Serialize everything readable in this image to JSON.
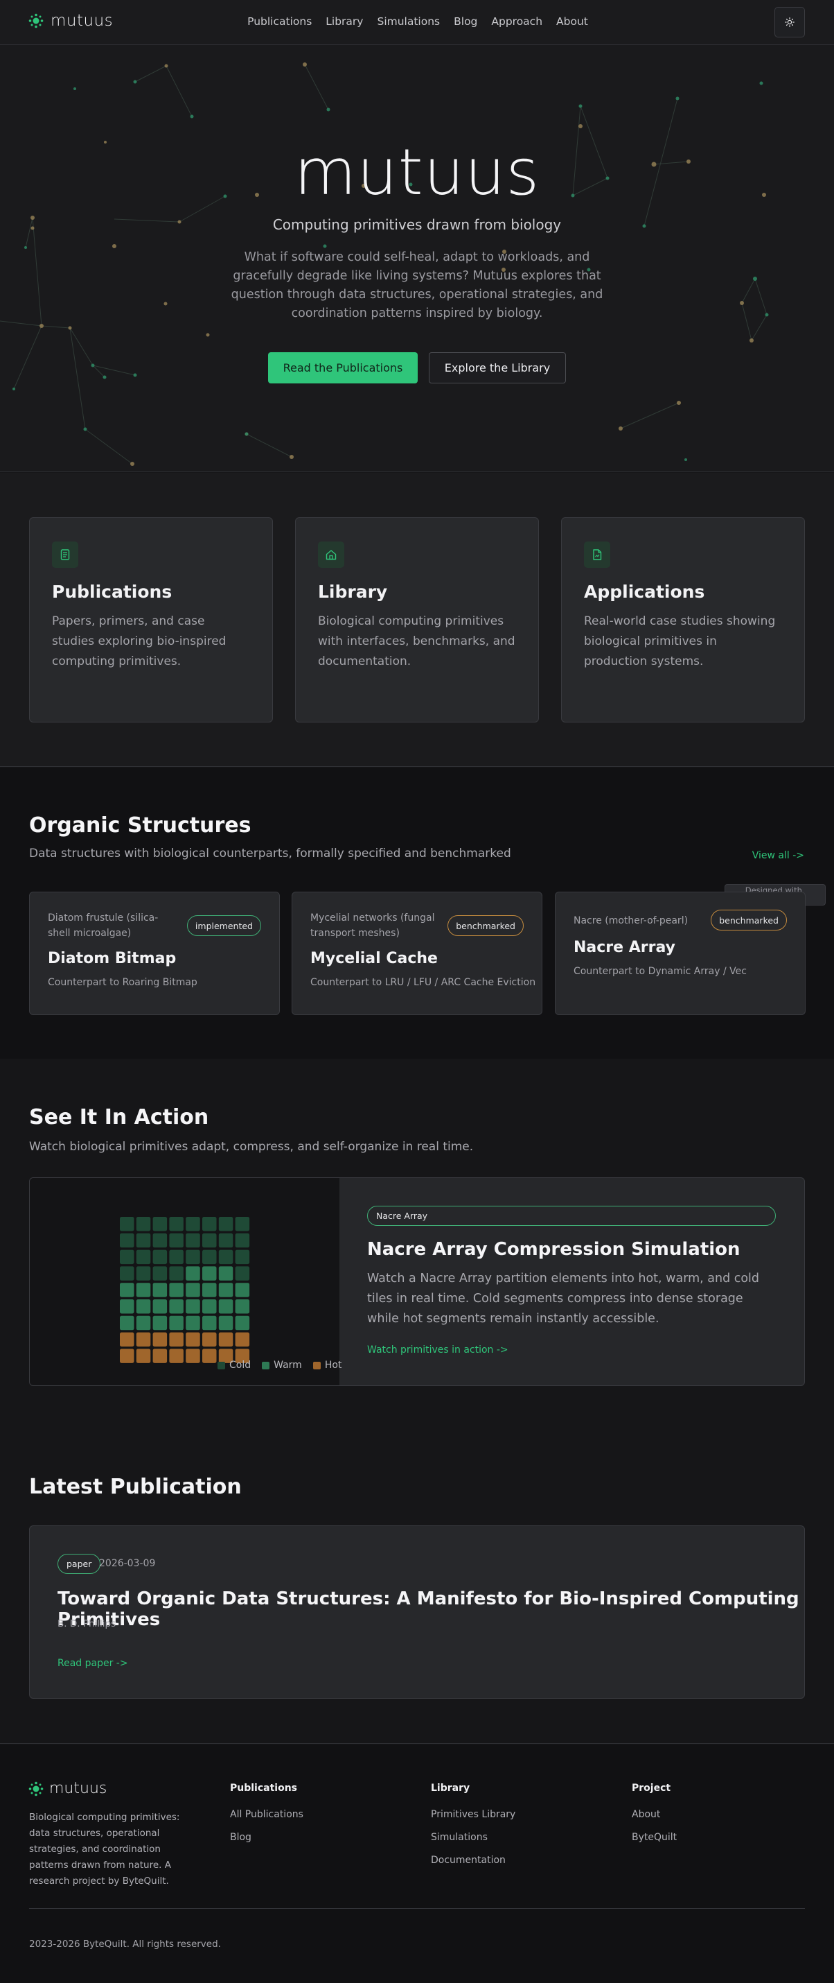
{
  "brand": {
    "name": "mutuus"
  },
  "nav": {
    "links": [
      "Publications",
      "Library",
      "Simulations",
      "Blog",
      "Approach",
      "About"
    ],
    "theme_icon": "sun-icon"
  },
  "hero": {
    "title": "mutuus",
    "subtitle": "Computing primitives drawn from biology",
    "description": "What if software could self-heal, adapt to workloads, and gracefully degrade like living systems? Mutuus explores that question through data structures, operational strategies, and coordination patterns inspired by biology.",
    "primary_cta": "Read the Publications",
    "secondary_cta": "Explore the Library"
  },
  "features": [
    {
      "icon": "document-icon",
      "title": "Publications",
      "description": "Papers, primers, and case studies exploring bio-inspired computing primitives."
    },
    {
      "icon": "home-icon",
      "title": "Library",
      "description": "Biological computing primitives with interfaces, benchmarks, and documentation."
    },
    {
      "icon": "file-icon",
      "title": "Applications",
      "description": "Real-world case studies showing biological primitives in production systems."
    }
  ],
  "organic": {
    "title": "Organic Structures",
    "subtitle": "Data structures with biological counterparts, formally specified and benchmarked",
    "view_all": "View all ->",
    "phino_badge": "Designed with Phino",
    "cards": [
      {
        "organism": "Diatom frustule (silica-shell microalgae)",
        "status": "implemented",
        "name": "Diatom Bitmap",
        "counterpart": "Counterpart to Roaring Bitmap"
      },
      {
        "organism": "Mycelial networks (fungal transport meshes)",
        "status": "benchmarked",
        "name": "Mycelial Cache",
        "counterpart": "Counterpart to LRU / LFU / ARC Cache Eviction"
      },
      {
        "organism": "Nacre (mother-of-pearl)",
        "status": "benchmarked",
        "name": "Nacre Array",
        "counterpart": "Counterpart to Dynamic Array / Vec"
      }
    ]
  },
  "action": {
    "title": "See It In Action",
    "subtitle": "Watch biological primitives adapt, compress, and self-organize in real time.",
    "pill": "Nacre Array",
    "demo_title": "Nacre Array Compression Simulation",
    "demo_description": "Watch a Nacre Array partition elements into hot, warm, and cold tiles in real time. Cold segments compress into dense storage while hot segments remain instantly accessible.",
    "demo_link": "Watch primitives in action ->",
    "legend": [
      {
        "label": "Cold",
        "color": "#1f4a36"
      },
      {
        "label": "Warm",
        "color": "#2e7a55"
      },
      {
        "label": "Hot",
        "color": "#a0662c"
      }
    ],
    "grid_rows": [
      [
        "cold",
        "cold",
        "cold",
        "cold",
        "cold",
        "cold",
        "cold",
        "cold"
      ],
      [
        "cold",
        "cold",
        "cold",
        "cold",
        "cold",
        "cold",
        "cold",
        "cold"
      ],
      [
        "cold",
        "cold",
        "cold",
        "cold",
        "cold",
        "cold",
        "cold",
        "cold"
      ],
      [
        "cold",
        "cold",
        "cold",
        "cold",
        "warm",
        "warm",
        "warm",
        "cold"
      ],
      [
        "warm",
        "warm",
        "warm",
        "warm",
        "warm",
        "warm",
        "warm",
        "warm"
      ],
      [
        "warm",
        "warm",
        "warm",
        "warm",
        "warm",
        "warm",
        "warm",
        "warm"
      ],
      [
        "warm",
        "warm",
        "warm",
        "warm",
        "warm",
        "warm",
        "warm",
        "warm"
      ],
      [
        "hot",
        "hot",
        "hot",
        "hot",
        "hot",
        "hot",
        "hot",
        "hot"
      ],
      [
        "hot",
        "hot",
        "hot",
        "hot",
        "hot",
        "hot",
        "hot",
        "hot"
      ]
    ]
  },
  "latest": {
    "title": "Latest Publication",
    "badge": "paper",
    "date": "2026-03-09",
    "paper_title": "Toward Organic Data Structures: A Manifesto for Bio-Inspired Computing Primitives",
    "author": "B. D. Phillips",
    "link": "Read paper ->"
  },
  "footer": {
    "brand": "mutuus",
    "description": "Biological computing primitives: data structures, operational strategies, and coordination patterns drawn from nature. A research project by ByteQuilt.",
    "columns": [
      {
        "heading": "Publications",
        "items": [
          "All Publications",
          "Blog"
        ]
      },
      {
        "heading": "Library",
        "items": [
          "Primitives Library",
          "Simulations",
          "Documentation"
        ]
      },
      {
        "heading": "Project",
        "items": [
          "About",
          "ByteQuilt"
        ]
      }
    ],
    "copyright": "2023-2026 ByteQuilt. All rights reserved."
  }
}
